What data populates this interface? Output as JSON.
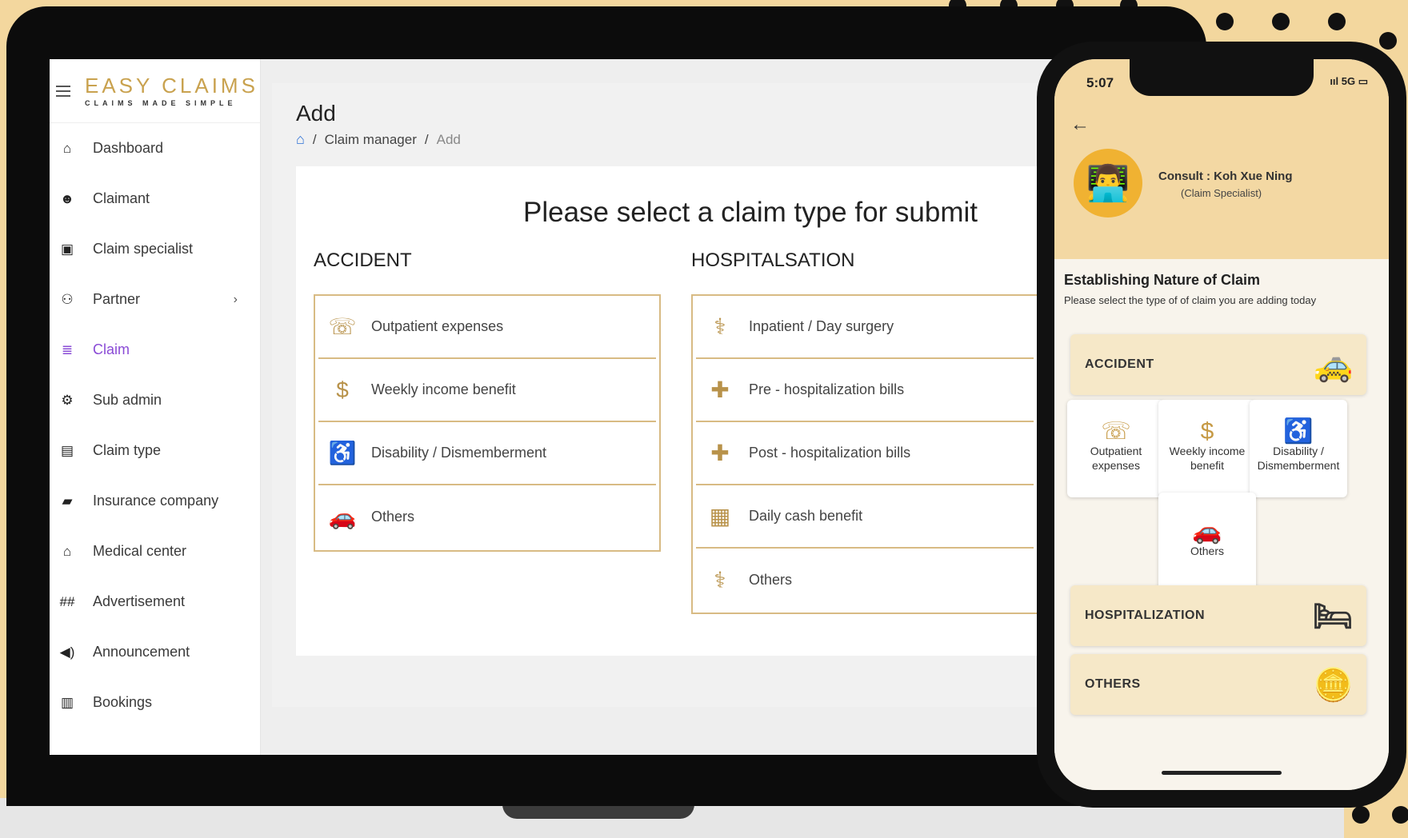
{
  "brand": {
    "title": "EASY CLAIMS",
    "tagline": "CLAIMS MADE SIMPLE"
  },
  "sidebar": {
    "items": [
      {
        "label": "Dashboard",
        "icon": "⌂"
      },
      {
        "label": "Claimant",
        "icon": "☻"
      },
      {
        "label": "Claim specialist",
        "icon": "▣"
      },
      {
        "label": "Partner",
        "icon": "⚇",
        "chevron": "›"
      },
      {
        "label": "Claim",
        "icon": "≣"
      },
      {
        "label": "Sub admin",
        "icon": "⚙"
      },
      {
        "label": "Claim type",
        "icon": "▤"
      },
      {
        "label": "Insurance company",
        "icon": "▰"
      },
      {
        "label": "Medical center",
        "icon": "⌂"
      },
      {
        "label": "Advertisement",
        "icon": "##"
      },
      {
        "label": "Announcement",
        "icon": "◀)"
      },
      {
        "label": "Bookings",
        "icon": "▥"
      }
    ]
  },
  "page": {
    "title": "Add",
    "breadcrumb": {
      "home_icon": "⌂",
      "sep": "/",
      "item1": "Claim manager",
      "current": "Add"
    },
    "heading": "Please select a claim type for submit",
    "accident": {
      "title": "ACCIDENT",
      "options": [
        {
          "label": "Outpatient expenses",
          "icon": "☏"
        },
        {
          "label": "Weekly income benefit",
          "icon": "$"
        },
        {
          "label": "Disability / Dismemberment",
          "icon": "♿"
        },
        {
          "label": "Others",
          "icon": "🚗"
        }
      ]
    },
    "hospital": {
      "title": "HOSPITALSATION",
      "options": [
        {
          "label": "Inpatient / Day surgery",
          "icon": "⚕"
        },
        {
          "label": "Pre - hospitalization bills",
          "icon": "✚"
        },
        {
          "label": "Post - hospitalization bills",
          "icon": "✚"
        },
        {
          "label": "Daily cash benefit",
          "icon": "▦"
        },
        {
          "label": "Others",
          "icon": "⚕"
        }
      ]
    }
  },
  "phone": {
    "time": "5:07",
    "status": "ııl 5G ▭",
    "back_icon": "←",
    "consult": "Consult : Koh Xue Ning",
    "consult_role": "(Claim Specialist)",
    "section_title": "Establishing Nature of Claim",
    "section_sub": "Please select the type of of claim you are adding today",
    "accident_label": "ACCIDENT",
    "tiles": [
      {
        "label1": "Outpatient",
        "label2": "expenses",
        "icon": "☏"
      },
      {
        "label1": "Weekly income",
        "label2": "benefit",
        "icon": "$"
      },
      {
        "label1": "Disability /",
        "label2": "Dismemberment",
        "icon": "♿"
      },
      {
        "label1": "Others",
        "label2": "",
        "icon": "🚗"
      }
    ],
    "hospital_label": "HOSPITALIZATION",
    "others_label": "OTHERS",
    "accent": "#f0b232"
  }
}
